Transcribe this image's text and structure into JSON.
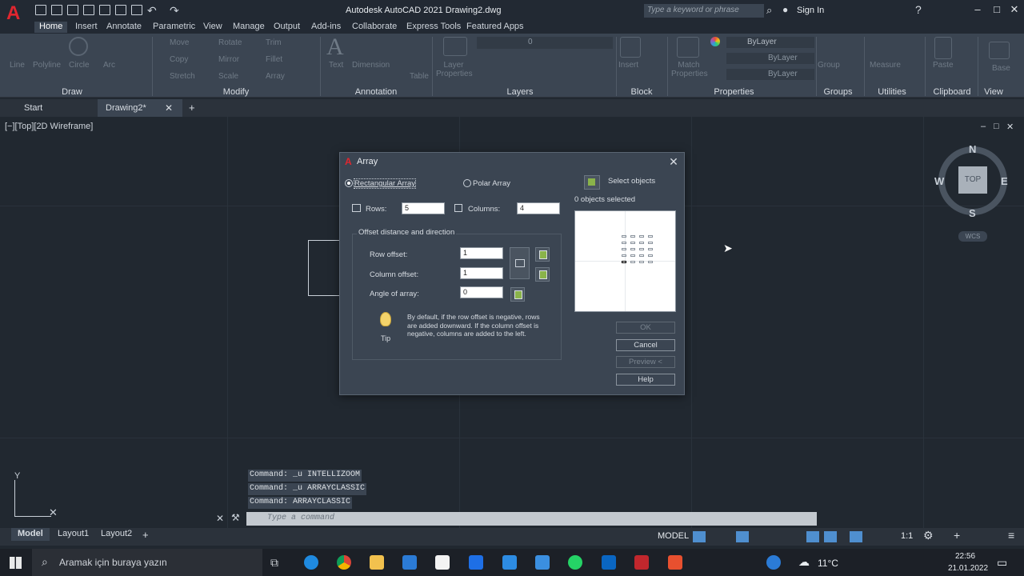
{
  "app": {
    "title": "Autodesk AutoCAD 2021   Drawing2.dwg",
    "logo_letter": "A",
    "search_placeholder": "Type a keyword or phrase",
    "sign_in": "Sign In",
    "accent_color": "#e0262f"
  },
  "ribbon_tabs": [
    "Home",
    "Insert",
    "Annotate",
    "Parametric",
    "View",
    "Manage",
    "Output",
    "Add-ins",
    "Collaborate",
    "Express Tools",
    "Featured Apps"
  ],
  "ribbon": {
    "draw": {
      "title": "Draw",
      "tools": [
        "Line",
        "Polyline",
        "Circle",
        "Arc"
      ]
    },
    "modify": {
      "title": "Modify",
      "tools": [
        "Move",
        "Rotate",
        "Trim",
        "Copy",
        "Mirror",
        "Fillet",
        "Stretch",
        "Scale",
        "Array"
      ]
    },
    "annotation": {
      "title": "Annotation",
      "tools": [
        "Text",
        "Dimension",
        "Table"
      ]
    },
    "layers": {
      "title": "Layers",
      "tools": [
        "Layer Properties"
      ],
      "current": "0"
    },
    "block": {
      "title": "Block",
      "tools": [
        "Insert"
      ]
    },
    "properties": {
      "title": "Properties",
      "tools": [
        "Match Properties"
      ],
      "values": [
        "ByLayer",
        "ByLayer",
        "ByLayer"
      ]
    },
    "groups": {
      "title": "Groups",
      "tools": [
        "Group"
      ]
    },
    "utilities": {
      "title": "Utilities",
      "tools": [
        "Measure"
      ]
    },
    "clipboard": {
      "title": "Clipboard",
      "tools": [
        "Paste"
      ]
    },
    "view": {
      "title": "View",
      "tools": [
        "Base"
      ]
    }
  },
  "doc_tabs": [
    "Start",
    "Drawing2*"
  ],
  "viewport": {
    "label": "[−][Top][2D Wireframe]",
    "viewcube_top": "TOP",
    "compass": {
      "n": "N",
      "s": "S",
      "e": "E",
      "w": "W"
    },
    "wcs": "WCS",
    "ucs_y": "Y"
  },
  "command_history": [
    "Command: _u INTELLIZOOM",
    "Command: _u ARRAYCLASSIC",
    "Command: ARRAYCLASSIC"
  ],
  "command_placeholder": "Type a command",
  "layout_tabs": [
    "Model",
    "Layout1",
    "Layout2"
  ],
  "status": {
    "model": "MODEL",
    "scale": "1:1"
  },
  "dialog": {
    "title": "Array",
    "rectangular": "Rectangular Array",
    "polar": "Polar Array",
    "select_objects": "Select objects",
    "objects_selected": "0 objects selected",
    "rows_label": "Rows:",
    "rows_value": "5",
    "columns_label": "Columns:",
    "columns_value": "4",
    "offset_group": "Offset distance and direction",
    "row_offset_label": "Row offset:",
    "row_offset_value": "1",
    "column_offset_label": "Column offset:",
    "column_offset_value": "1",
    "angle_label": "Angle of array:",
    "angle_value": "0",
    "tip_text": "By default, if the row offset is negative, rows are added downward.  If the column offset is negative, columns are added to the left.",
    "tip_label": "Tip",
    "buttons": {
      "ok": "OK",
      "cancel": "Cancel",
      "preview": "Preview <",
      "help": "Help"
    },
    "preview_rows": 5,
    "preview_cols": 4
  },
  "taskbar": {
    "search": "Aramak için buraya yazın",
    "weather": "11°C",
    "time": "22:56",
    "date": "21.01.2022"
  }
}
